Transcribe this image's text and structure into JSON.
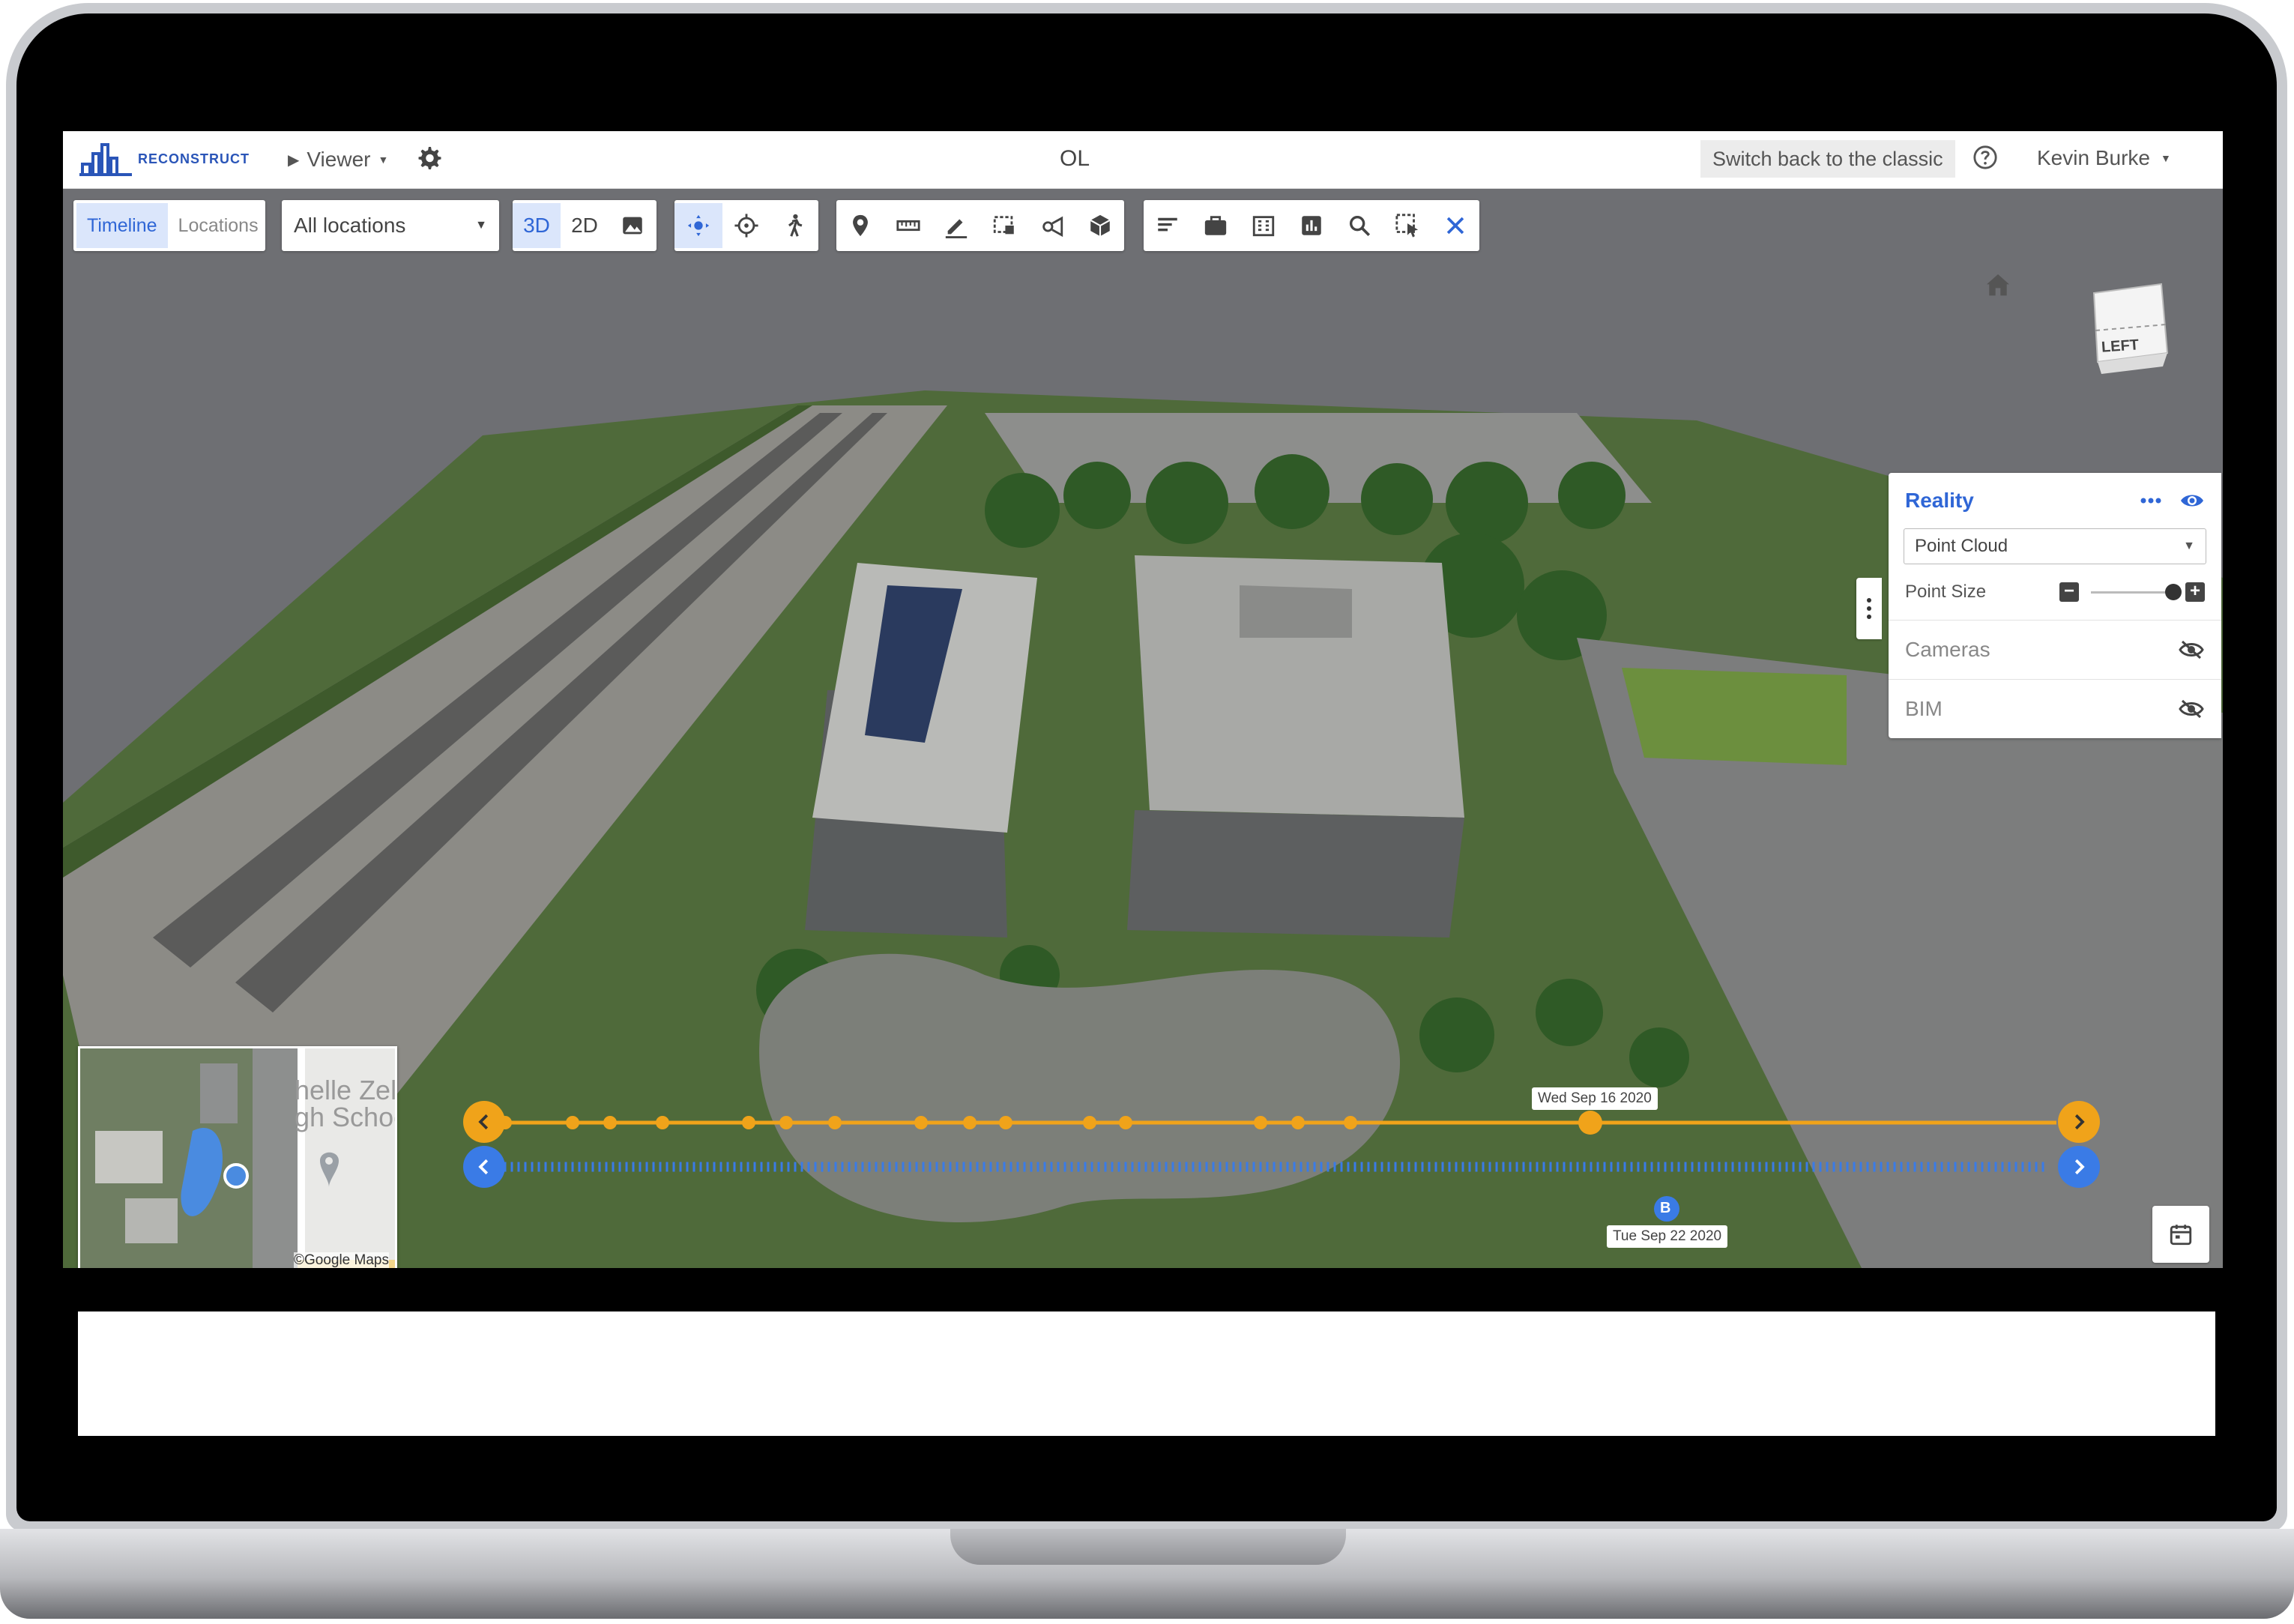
{
  "app": {
    "logo_text": "RECONSTRUCT",
    "viewer_label": "Viewer",
    "project_title": "OL",
    "classic_button": "Switch back to the classic",
    "user_name": "Kevin Burke"
  },
  "toolbar": {
    "tabs": [
      "Timeline",
      "Locations"
    ],
    "active_tab": "Timeline",
    "location_select": "All locations",
    "view_modes": [
      "3D",
      "2D"
    ],
    "active_view": "3D"
  },
  "panel": {
    "title": "Reality",
    "select_value": "Point Cloud",
    "point_size_label": "Point Size",
    "point_size_level": 1.0,
    "layers": [
      {
        "label": "Cameras",
        "visible": false
      },
      {
        "label": "BIM",
        "visible": false
      }
    ]
  },
  "orientation_cube": {
    "face_label": "LEFT"
  },
  "minimap": {
    "credit": "©Google Maps",
    "map_label": "helle Zel\ngh Schoo"
  },
  "timeline": {
    "top_date": "Wed Sep 16 2020",
    "bottom_date": "Tue Sep 22 2020",
    "bottom_marker": "B"
  },
  "colors": {
    "accent_blue": "#2f66d6",
    "timeline_orange": "#f0a31a",
    "timeline_blue": "#3a7be6"
  }
}
